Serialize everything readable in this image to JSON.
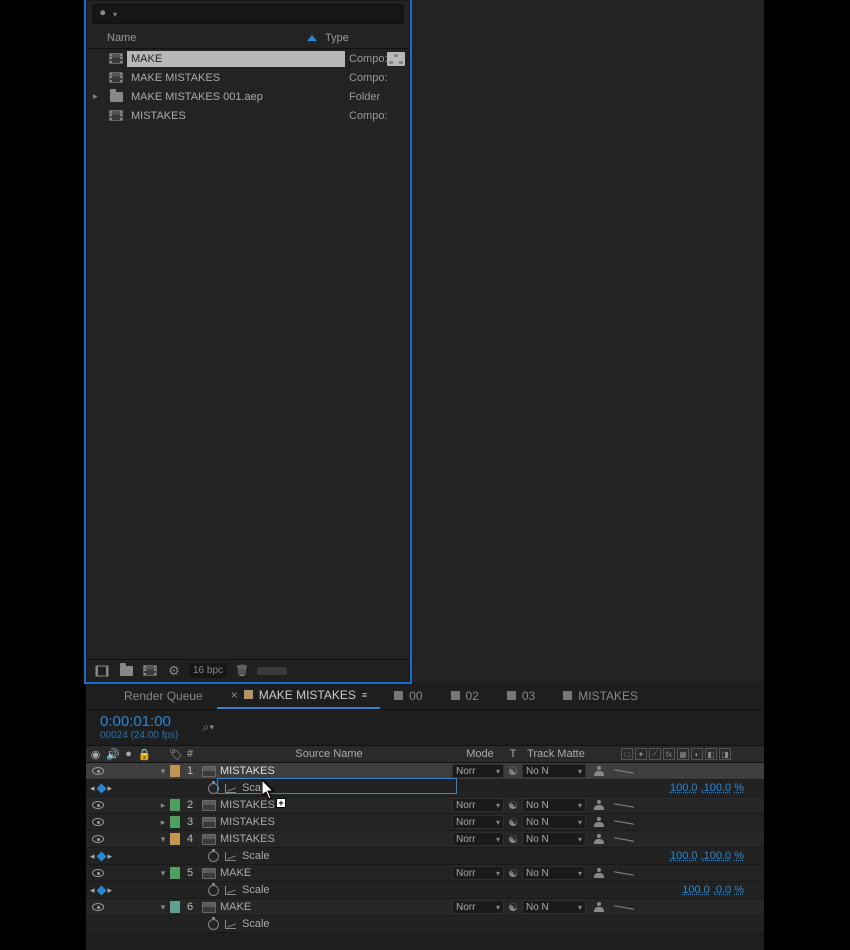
{
  "project": {
    "search_placeholder": "",
    "columns": {
      "name": "Name",
      "type": "Type"
    },
    "rows": [
      {
        "name": "MAKE",
        "type": "Compo:",
        "icon": "comp",
        "selected": true,
        "flowchart": true
      },
      {
        "name": "MAKE MISTAKES",
        "type": "Compo:",
        "icon": "comp"
      },
      {
        "name": "MAKE MISTAKES 001.aep",
        "type": "Folder",
        "icon": "folder",
        "twirl": true
      },
      {
        "name": "MISTAKES",
        "type": "Compo:",
        "icon": "comp"
      }
    ],
    "footer_bpc": "16 bpc"
  },
  "timeline": {
    "tabs": {
      "render_queue": "Render Queue",
      "active": "MAKE MISTAKES",
      "others": [
        "00",
        "02",
        "03",
        "MISTAKES"
      ]
    },
    "timecode": "0:00:01:00",
    "timecode_sub": "00024 (24.00 fps)",
    "headers": {
      "num": "#",
      "source_name": "Source Name",
      "mode": "Mode",
      "t": "T",
      "track_matte": "Track Matte"
    },
    "mode_value": "Norr",
    "trk_value": "No N",
    "scale_label": "Scale",
    "layers": [
      {
        "num": 1,
        "name": "MISTAKES",
        "color": "c-orange",
        "open": true,
        "scale_a": "100.0",
        "scale_b": "100.0",
        "selected": true,
        "kfnav": true
      },
      {
        "num": 2,
        "name": "MISTAKES",
        "color": "c-green",
        "open": false
      },
      {
        "num": 3,
        "name": "MISTAKES",
        "color": "c-green",
        "open": false
      },
      {
        "num": 4,
        "name": "MISTAKES",
        "color": "c-orange",
        "open": true,
        "scale_a": "100.0",
        "scale_b": "100.0",
        "kfnav": true
      },
      {
        "num": 5,
        "name": "MAKE",
        "color": "c-green",
        "open": true,
        "scale_a": "100.0",
        "scale_b": "0.0",
        "kfnav_empty": true
      },
      {
        "num": 6,
        "name": "MAKE",
        "color": "c-cyan",
        "open": true,
        "scale_a": "",
        "scale_b": ""
      }
    ],
    "pct": "%"
  }
}
